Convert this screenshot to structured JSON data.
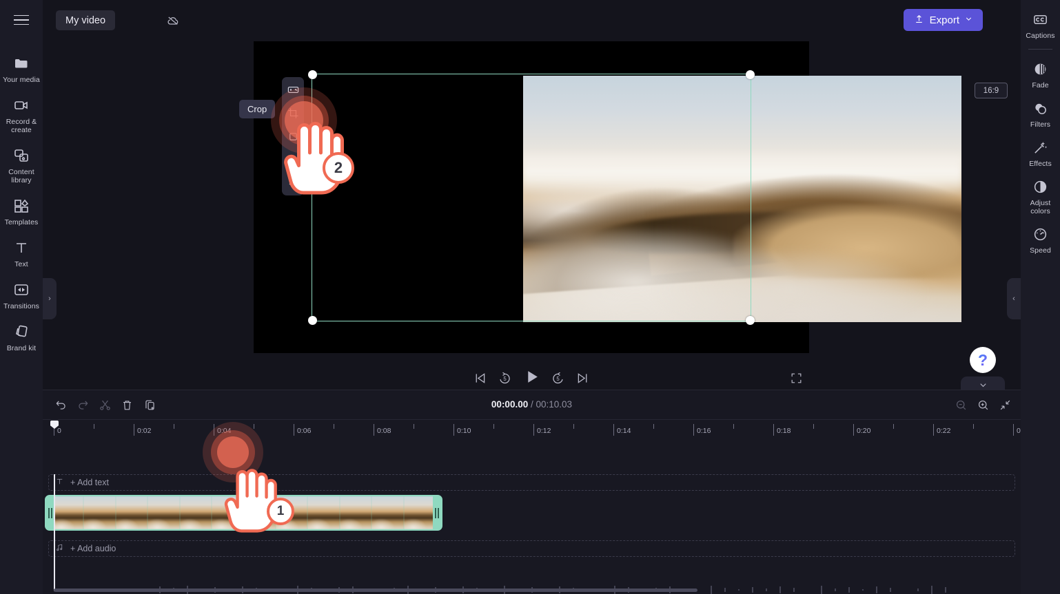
{
  "app": {
    "project_name": "My video",
    "export_label": "Export",
    "aspect_ratio": "16:9",
    "help_glyph": "?"
  },
  "left_sidebar": {
    "menu_icon": "hamburger-icon",
    "items": [
      {
        "label": "Your media",
        "icon": "folder-icon"
      },
      {
        "label": "Record &\ncreate",
        "icon": "video-camera-icon"
      },
      {
        "label": "Content\nlibrary",
        "icon": "content-library-icon"
      },
      {
        "label": "Templates",
        "icon": "templates-icon"
      },
      {
        "label": "Text",
        "icon": "text-icon"
      },
      {
        "label": "Transitions",
        "icon": "transitions-icon"
      },
      {
        "label": "Brand kit",
        "icon": "brand-kit-icon"
      }
    ],
    "collapse_glyph": "›"
  },
  "right_sidebar": {
    "items": [
      {
        "label": "Captions",
        "icon": "closed-caption-icon"
      },
      {
        "label": "Fade",
        "icon": "fade-icon"
      },
      {
        "label": "Filters",
        "icon": "filters-icon"
      },
      {
        "label": "Effects",
        "icon": "magic-wand-icon"
      },
      {
        "label": "Adjust\ncolors",
        "icon": "contrast-icon"
      },
      {
        "label": "Speed",
        "icon": "speedometer-icon"
      }
    ],
    "collapse_glyph": "‹"
  },
  "preview": {
    "float_tools": [
      {
        "name": "fit-to-frame-icon"
      },
      {
        "name": "crop-icon"
      },
      {
        "name": "picture-in-picture-icon"
      },
      {
        "name": "flip-horizontal-icon"
      },
      {
        "name": "flip-vertical-icon"
      }
    ],
    "tooltip": "Crop",
    "transport": [
      {
        "name": "skip-to-start-button"
      },
      {
        "name": "rewind-5-button",
        "glyph": "5"
      },
      {
        "name": "play-button"
      },
      {
        "name": "forward-5-button",
        "glyph": "5"
      },
      {
        "name": "skip-to-end-button"
      },
      {
        "name": "fullscreen-button"
      }
    ]
  },
  "timeline": {
    "toolbar": [
      {
        "name": "undo-button"
      },
      {
        "name": "redo-button"
      },
      {
        "name": "split-button"
      },
      {
        "name": "delete-button"
      },
      {
        "name": "duplicate-button"
      }
    ],
    "zoom_tools": [
      {
        "name": "zoom-out-button"
      },
      {
        "name": "zoom-in-button"
      },
      {
        "name": "fit-timeline-button"
      }
    ],
    "current_time": "00:00.00",
    "separator": "/",
    "total_time": "00:10.03",
    "ruler_ticks": [
      "0",
      "0:02",
      "0:04",
      "0:06",
      "0:08",
      "0:10",
      "0:12",
      "0:14",
      "0:16",
      "0:18",
      "0:20",
      "0:22",
      "0"
    ],
    "text_track_label": "+ Add text",
    "audio_track_label": "+ Add audio",
    "video_clip_name": "video-clip"
  },
  "annotations": [
    {
      "number": "1",
      "target": "video-clip-on-timeline"
    },
    {
      "number": "2",
      "target": "crop-tool-button"
    }
  ]
}
